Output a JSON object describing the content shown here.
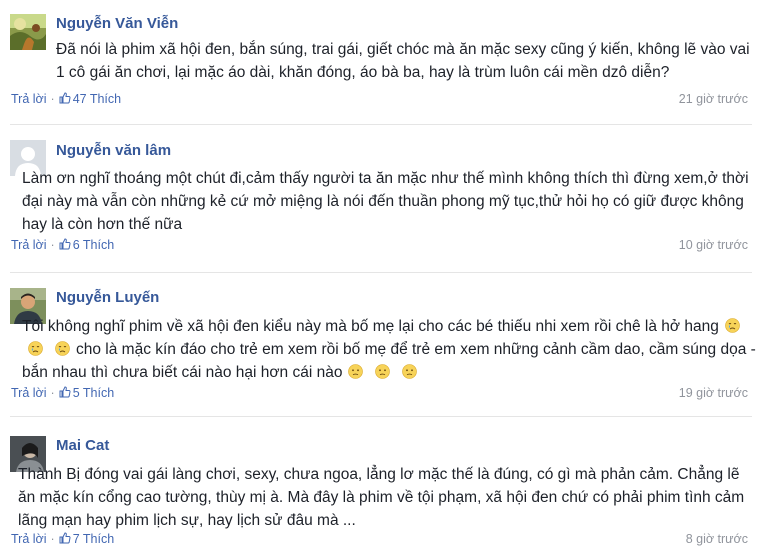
{
  "comments": [
    {
      "author": "Nguyễn Văn Viễn",
      "avatar": "avatar-photo-nature",
      "text": "Đã nói là phim xã hội đen, bắn súng, trai gái, giết chóc mà ăn mặc sexy cũng ý kiến, không lẽ vào vai 1 cô gái ăn chơi, lại mặc áo dài, khăn đóng, áo bà ba, hay là trùm luôn cái mền dzô diễn?",
      "reply_label": "Trả lời",
      "likes_label": "47 Thích",
      "time": "21 giờ trước"
    },
    {
      "author": "Nguyễn văn lâm",
      "avatar": "avatar-default-silhouette",
      "text": "Làm ơn nghĩ thoáng một chút đi,cảm thấy người ta ăn mặc như thế mình không thích thì đừng xem,ở thời đại này mà vẫn còn những kẻ cứ mở miệng là nói đến thuần phong mỹ tục,thử hỏi họ có giữ được không hay là còn hơn thế nữa",
      "reply_label": "Trả lời",
      "likes_label": "6 Thích",
      "time": "10 giờ trước"
    },
    {
      "author": "Nguyễn Luyến",
      "avatar": "avatar-photo-man",
      "text_parts": [
        "Tôi không nghĩ phim về xã hội đen kiểu này mà bố mẹ lại cho các bé thiếu nhi xem rồi chê là hở hang",
        "cho là mặc kín đáo cho trẻ em xem rồi bố mẹ để trẻ em xem những cảnh cầm dao, cầm súng dọa -bắn nhau thì chưa biết cái nào hại hơn cái nào"
      ],
      "emoji_crying": "crying-face-icon",
      "emoji_worried": "worried-face-icon",
      "reply_label": "Trả lời",
      "likes_label": "5 Thích",
      "time": "19 giờ trước"
    },
    {
      "author": "Mai Cat",
      "avatar": "avatar-photo-person",
      "text": "Thành Bị đóng vai gái làng chơi, sexy, chưa ngoa, lẳng lơ mặc thế là đúng, có gì mà phản cảm. Chẳng lẽ ăn mặc kín cổng cao tường, thùy mị à. Mà đây là phim về tội phạm, xã hội đen chứ có phải phim tình cảm lãng mạn hay phim lịch sự, hay lịch sử đâu mà ...",
      "reply_label": "Trả lời",
      "likes_label": "7 Thích",
      "time": "8 giờ trước"
    }
  ],
  "colors": {
    "name": "#365899",
    "link": "#4267b2",
    "meta": "#90949c",
    "text": "#1d2129",
    "divider": "#e5e5e5"
  }
}
